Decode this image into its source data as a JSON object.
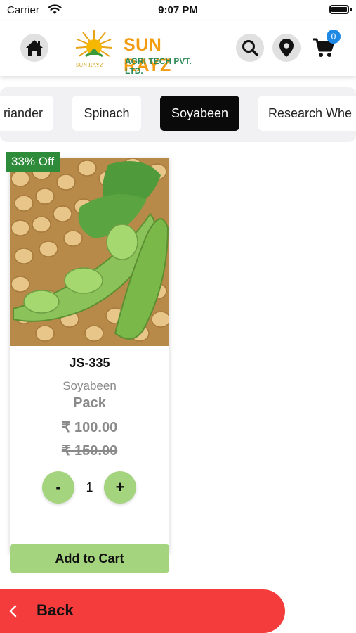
{
  "status_bar": {
    "carrier": "Carrier",
    "time": "9:07 PM"
  },
  "header": {
    "logo_name": "SUN RAYZ",
    "logo_subtitle": "AGRI TECH PVT. LTD.",
    "logo_mark_text": "SUN RAYZ",
    "cart_count": "0",
    "icons": [
      "home-icon",
      "search-icon",
      "location-pin-icon",
      "cart-icon"
    ]
  },
  "categories": [
    {
      "label": "riander",
      "active": false
    },
    {
      "label": "Spinach",
      "active": false
    },
    {
      "label": "Soyabeen",
      "active": true
    },
    {
      "label": "Research Whe",
      "active": false
    }
  ],
  "product": {
    "discount": "33% Off",
    "name": "JS-335",
    "category": "Soyabeen",
    "unit": "Pack",
    "price": "₹ 100.00",
    "old_price": "₹ 150.00",
    "quantity": "1",
    "minus_label": "-",
    "plus_label": "+",
    "add_to_cart": "Add to Cart"
  },
  "back": {
    "label": "Back"
  },
  "colors": {
    "accent_green": "#a5d47f",
    "discount_green": "#2e8b3a",
    "back_red": "#f53c3c",
    "badge_blue": "#1e88e5",
    "logo_orange": "#f39c12"
  }
}
